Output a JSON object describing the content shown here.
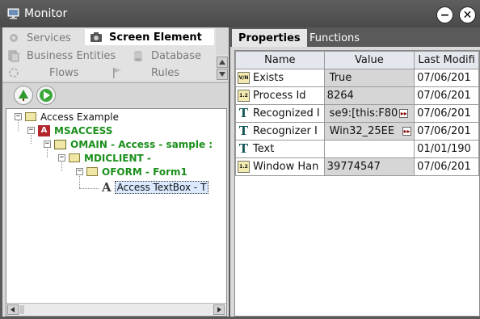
{
  "window": {
    "title": "Monitor"
  },
  "nav": {
    "items": [
      {
        "label": "Services",
        "icon": "gear-icon"
      },
      {
        "label": "Screen Element",
        "icon": "camera-icon",
        "active": true
      },
      {
        "label": "Business Entities",
        "icon": "entities-icon"
      },
      {
        "label": "Database",
        "icon": "database-icon"
      },
      {
        "label": "Flows",
        "icon": "flows-icon"
      },
      {
        "label": "Rules",
        "icon": "flag-icon"
      }
    ]
  },
  "tree": {
    "nodes": [
      {
        "label": "Access Example",
        "level": 0,
        "style": "normal",
        "icon": "folder-icon"
      },
      {
        "label": "MSACCESS",
        "level": 1,
        "style": "green",
        "icon": "access-app-icon"
      },
      {
        "label": "OMAIN - Access - sample :",
        "level": 2,
        "style": "green",
        "icon": "window-icon"
      },
      {
        "label": "MDICLIENT -",
        "level": 3,
        "style": "green",
        "icon": "folder-icon"
      },
      {
        "label": "OFORM - Form1",
        "level": 4,
        "style": "green",
        "icon": "folder-icon"
      },
      {
        "label": "Access TextBox - T",
        "level": 5,
        "style": "selected",
        "icon": "textbox-icon"
      }
    ]
  },
  "tabs": [
    {
      "label": "Properties",
      "active": true
    },
    {
      "label": "Functions",
      "active": false
    }
  ],
  "properties": {
    "columns": [
      "Name",
      "Value",
      "Last Modifi"
    ],
    "rows": [
      {
        "name": "Exists",
        "value": "True",
        "modified": "07/06/201",
        "icon": "boolean-icon",
        "has_more": false
      },
      {
        "name": "Process Id",
        "value": "8264",
        "modified": "07/06/201",
        "icon": "number-icon",
        "has_more": false
      },
      {
        "name": "Recognized I",
        "value": "se9:[this:F80",
        "modified": "07/06/201",
        "icon": "text-icon",
        "has_more": true
      },
      {
        "name": "Recognizer I",
        "value": "Win32_25EE",
        "modified": "07/06/201",
        "icon": "text-icon",
        "has_more": true
      },
      {
        "name": "Text",
        "value": "",
        "modified": "01/01/190",
        "icon": "text-icon",
        "has_more": false
      },
      {
        "name": "Window Han",
        "value": "39774547",
        "modified": "07/06/201",
        "icon": "number-icon",
        "has_more": false
      }
    ]
  },
  "colors": {
    "titlebar": "#4a4a4a",
    "tree_green": "#1b8f1b",
    "tab_active": "#e6e6e6"
  }
}
